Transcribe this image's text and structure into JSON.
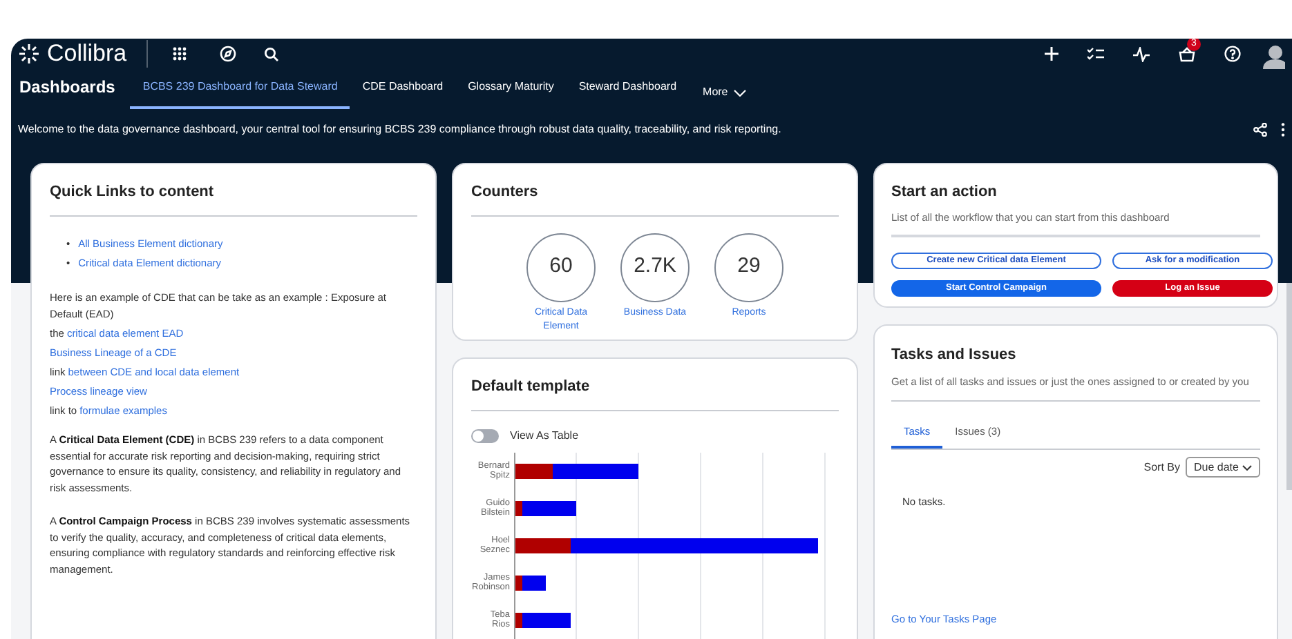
{
  "app": {
    "logo": "Collibra",
    "notification_count": "3"
  },
  "nav": {
    "title": "Dashboards",
    "more": "More",
    "tabs": [
      {
        "label": "BCBS 239 Dashboard for Data Steward",
        "selected": true
      },
      {
        "label": "CDE Dashboard",
        "selected": false
      },
      {
        "label": "Glossary Maturity",
        "selected": false
      },
      {
        "label": "Steward Dashboard",
        "selected": false
      }
    ]
  },
  "welcome": "Welcome to the data governance dashboard, your central tool for ensuring BCBS 239 compliance through robust data quality, traceability, and risk reporting.",
  "quick_links": {
    "title": "Quick Links to content",
    "links": [
      {
        "marker": "•",
        "label": "All Business Element dictionary"
      },
      {
        "marker": "•",
        "label": "Critical data Element dictionary"
      }
    ],
    "intro": "Here is an example of CDE that can be take as an example : Exposure at Default (EAD)",
    "lines": [
      {
        "prefix": "the",
        "link": "critical data element EAD"
      },
      {
        "link": "Business Lineage of a CDE"
      },
      {
        "prefix": "link",
        "link": "between CDE and local data element"
      },
      {
        "link": "Process lineage view"
      },
      {
        "prefix": "link to",
        "link": "formulae examples"
      }
    ],
    "paragraphs": [
      "A **Critical Data Element (CDE)** in BCBS 239 refers to a data component essential for accurate risk reporting and decision-making, requiring strict governance to ensure its quality, consistency, and reliability in regulatory and risk assessments.",
      "A **Control Campaign Process** in BCBS 239 involves systematic assessments to verify the quality, accuracy, and completeness of critical data elements, ensuring compliance with regulatory standards and reinforcing effective risk management."
    ]
  },
  "counters": {
    "title": "Counters",
    "items": [
      {
        "value": "60",
        "label": "Critical Data Element"
      },
      {
        "value": "2.7K",
        "label": "Business Data"
      },
      {
        "value": "29",
        "label": "Reports"
      }
    ]
  },
  "template": {
    "title": "Default template",
    "toggle": {
      "label": "View As Table",
      "on": false
    },
    "bar_labels": [
      "Bernard Spitz",
      "Guido Bilstein",
      "Hoel Seznec",
      "James Robinson",
      "Teba Rios"
    ]
  },
  "actions": {
    "title": "Start an action",
    "subtitle": "List of all the workflow that you can start from this dashboard",
    "buttons": [
      {
        "label": "Create new Critical data Element",
        "kind": "outline"
      },
      {
        "label": "Ask for a modification",
        "kind": "outline"
      },
      {
        "label": "Start Control Campaign",
        "kind": "primary"
      },
      {
        "label": "Log an Issue",
        "kind": "danger"
      }
    ]
  },
  "tasks": {
    "title": "Tasks and Issues",
    "subtitle": "Get a list of all tasks and issues or just the ones assigned to or created by you",
    "tabs": [
      {
        "label": "Tasks",
        "selected": true
      },
      {
        "label": "Issues (3)",
        "selected": false
      }
    ],
    "sort": {
      "label": "Sort By",
      "value": "Due date"
    },
    "empty": "No tasks.",
    "footer_link": "Go to Your Tasks Page"
  }
}
